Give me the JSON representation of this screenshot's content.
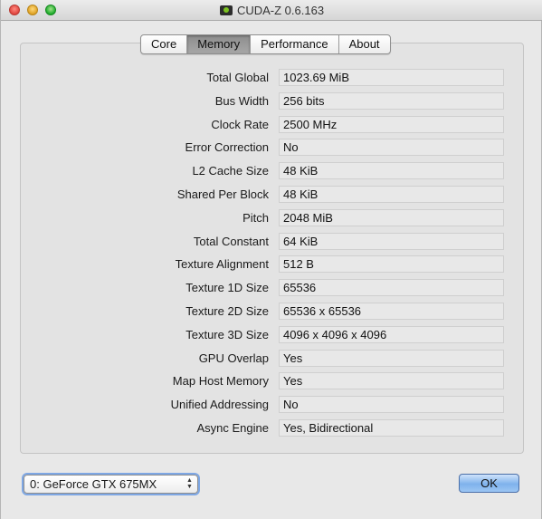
{
  "window": {
    "title": "CUDA-Z 0.6.163"
  },
  "tabs": [
    {
      "label": "Core",
      "active": false
    },
    {
      "label": "Memory",
      "active": true
    },
    {
      "label": "Performance",
      "active": false
    },
    {
      "label": "About",
      "active": false
    }
  ],
  "memory": {
    "rows": [
      {
        "label": "Total Global",
        "value": "1023.69 MiB"
      },
      {
        "label": "Bus Width",
        "value": "256 bits"
      },
      {
        "label": "Clock Rate",
        "value": "2500 MHz"
      },
      {
        "label": "Error Correction",
        "value": "No"
      },
      {
        "label": "L2 Cache Size",
        "value": "48 KiB"
      },
      {
        "label": "Shared Per Block",
        "value": "48 KiB"
      },
      {
        "label": "Pitch",
        "value": "2048 MiB"
      },
      {
        "label": "Total Constant",
        "value": "64 KiB"
      },
      {
        "label": "Texture Alignment",
        "value": "512 B"
      },
      {
        "label": "Texture 1D Size",
        "value": "65536"
      },
      {
        "label": "Texture 2D Size",
        "value": "65536 x 65536"
      },
      {
        "label": "Texture 3D Size",
        "value": "4096 x 4096 x 4096"
      },
      {
        "label": "GPU Overlap",
        "value": "Yes"
      },
      {
        "label": "Map Host Memory",
        "value": "Yes"
      },
      {
        "label": "Unified Addressing",
        "value": "No"
      },
      {
        "label": "Async Engine",
        "value": "Yes, Bidirectional"
      }
    ]
  },
  "footer": {
    "device_selected": "0: GeForce GTX 675MX",
    "ok_label": "OK"
  }
}
